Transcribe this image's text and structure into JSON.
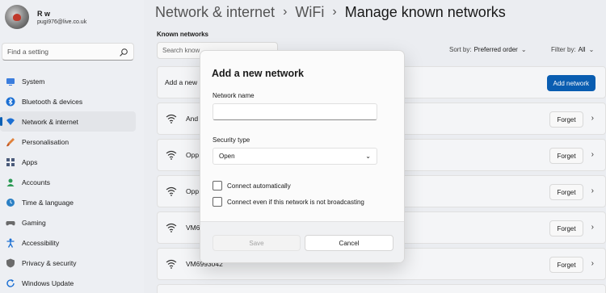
{
  "profile": {
    "name": "R w",
    "email": "pugi976@live.co.uk"
  },
  "search": {
    "placeholder": "Find a setting"
  },
  "sidebar": {
    "items": [
      {
        "label": "System",
        "icon": "system-icon",
        "color": "#3b7ddd"
      },
      {
        "label": "Bluetooth & devices",
        "icon": "bluetooth-icon",
        "color": "#1b6fd3"
      },
      {
        "label": "Network & internet",
        "icon": "network-icon",
        "color": "#1b6fd3",
        "active": true
      },
      {
        "label": "Personalisation",
        "icon": "brush-icon",
        "color": "#e0813b"
      },
      {
        "label": "Apps",
        "icon": "apps-icon",
        "color": "#4a5a7a"
      },
      {
        "label": "Accounts",
        "icon": "accounts-icon",
        "color": "#2d9a55"
      },
      {
        "label": "Time & language",
        "icon": "globe-clock-icon",
        "color": "#2a7fc4"
      },
      {
        "label": "Gaming",
        "icon": "gaming-icon",
        "color": "#6b6b6b"
      },
      {
        "label": "Accessibility",
        "icon": "accessibility-icon",
        "color": "#1b6fd3"
      },
      {
        "label": "Privacy & security",
        "icon": "shield-icon",
        "color": "#6b6b6b"
      },
      {
        "label": "Windows Update",
        "icon": "update-icon",
        "color": "#1b6fd3"
      }
    ]
  },
  "breadcrumb": {
    "seg1": "Network & internet",
    "seg2": "WiFi",
    "current": "Manage known networks",
    "separator": "›"
  },
  "known": {
    "label": "Known networks",
    "search_placeholder": "Search know",
    "sort_label": "Sort by:",
    "sort_value": "Preferred order",
    "filter_label": "Filter by:",
    "filter_value": "All",
    "add_label": "Add a new",
    "add_button": "Add network",
    "forget": "Forget",
    "networks": [
      "And",
      "Opp",
      "Opp",
      "VM6",
      "VM6993042"
    ]
  },
  "dialog": {
    "title": "Add a new network",
    "name_label": "Network name",
    "name_value": "",
    "security_label": "Security type",
    "security_value": "Open",
    "check_auto": "Connect automatically",
    "check_broadcast": "Connect even if this network is not broadcasting",
    "save": "Save",
    "cancel": "Cancel"
  },
  "colors": {
    "accent": "#0a5fb4"
  }
}
